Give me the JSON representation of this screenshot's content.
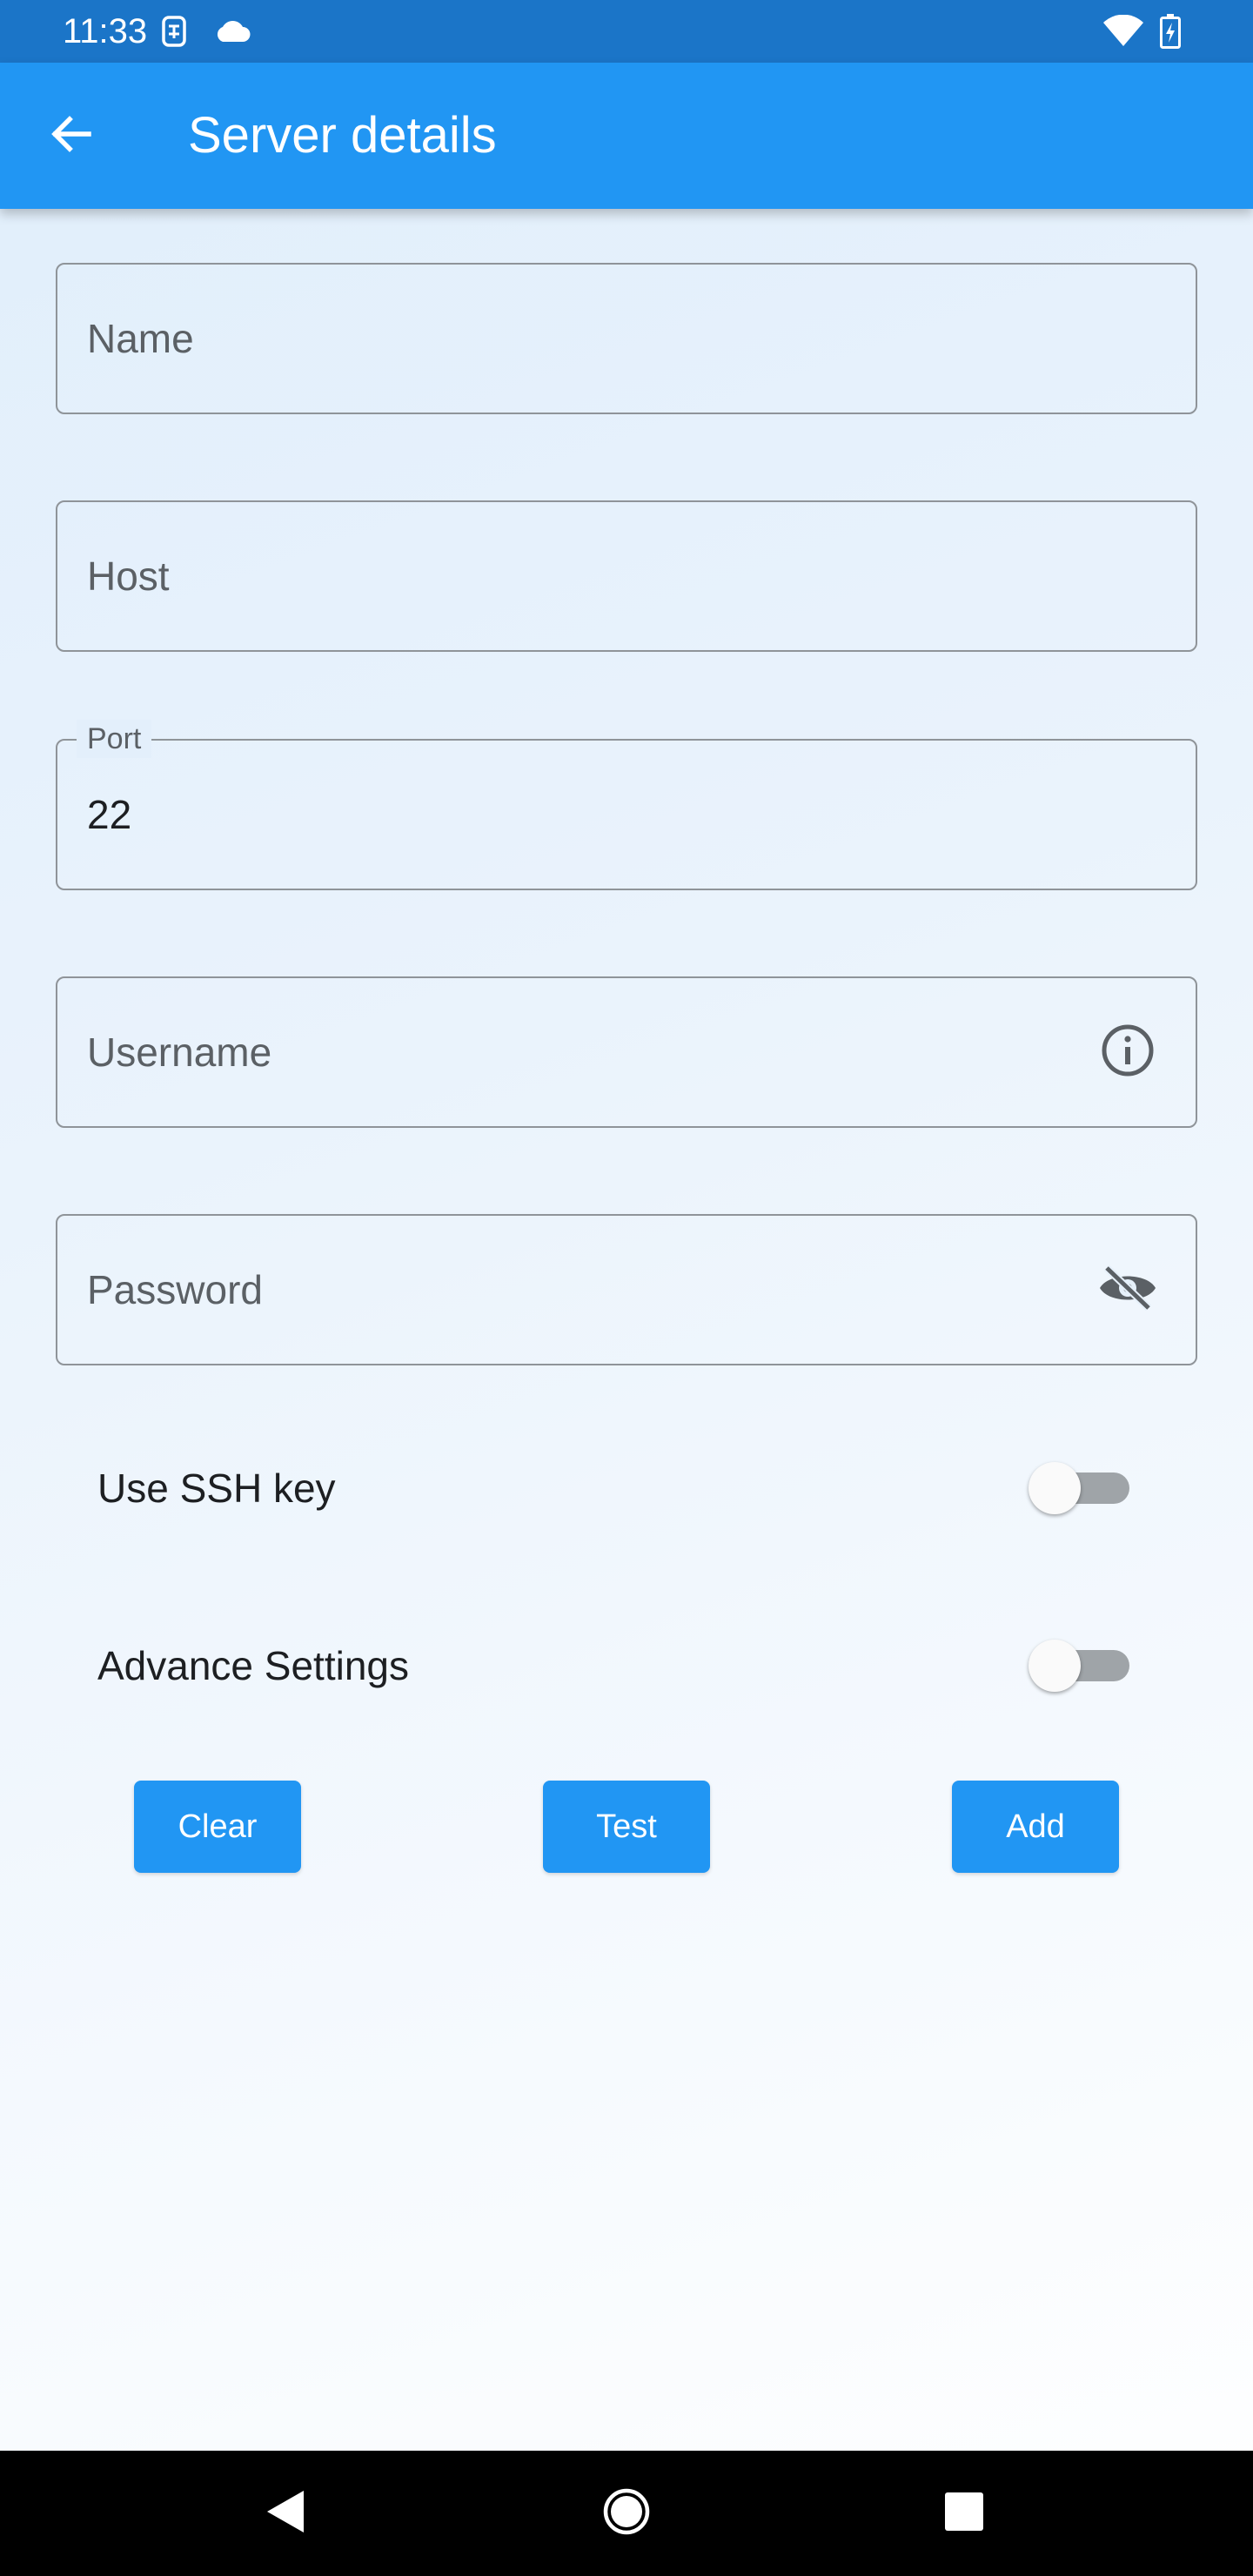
{
  "status_bar": {
    "time": "11:33",
    "icons_left": [
      "sim-card-icon",
      "cloud-icon"
    ],
    "icons_right": [
      "wifi-icon",
      "battery-charging-icon"
    ]
  },
  "app_bar": {
    "title": "Server details",
    "back_icon": "arrow-back-icon"
  },
  "form": {
    "name": {
      "placeholder": "Name",
      "value": ""
    },
    "host": {
      "placeholder": "Host",
      "value": ""
    },
    "port": {
      "label": "Port",
      "value": "22"
    },
    "username": {
      "placeholder": "Username",
      "value": "",
      "suffix_icon": "info-icon"
    },
    "password": {
      "placeholder": "Password",
      "value": "",
      "suffix_icon": "visibility-off-icon"
    }
  },
  "toggles": {
    "ssh_key": {
      "label": "Use SSH key",
      "checked": false
    },
    "advance_settings": {
      "label": "Advance Settings",
      "checked": false
    }
  },
  "actions": {
    "clear": "Clear",
    "test": "Test",
    "add": "Add"
  },
  "nav_bar": {
    "icons": [
      "back-triangle-icon",
      "home-circle-icon",
      "recents-square-icon"
    ]
  },
  "colors": {
    "status_bar": "#1b75c8",
    "app_bar": "#2196f3",
    "button": "#2196f3",
    "field_border": "#8f9499"
  }
}
